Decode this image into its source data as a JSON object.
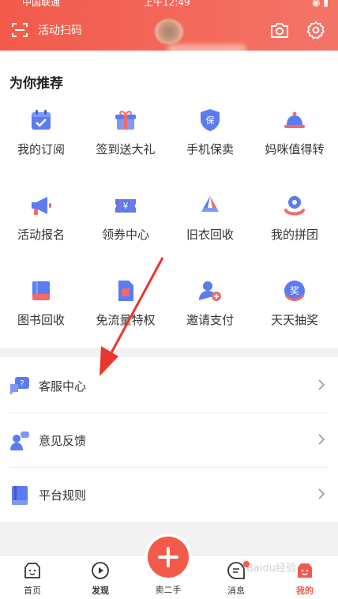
{
  "status_bar": {
    "carrier": "中国联通",
    "time": "上午12:49"
  },
  "header": {
    "scan_label": "活动扫码"
  },
  "recommend": {
    "title": "为你推荐",
    "items": [
      {
        "label": "我的订阅",
        "icon": "calendar-icon"
      },
      {
        "label": "签到送大礼",
        "icon": "gift-icon"
      },
      {
        "label": "手机保卖",
        "icon": "shield-icon"
      },
      {
        "label": "妈咪值得转",
        "icon": "bell-icon"
      },
      {
        "label": "活动报名",
        "icon": "megaphone-icon"
      },
      {
        "label": "领券中心",
        "icon": "coupon-icon"
      },
      {
        "label": "旧衣回收",
        "icon": "recycle-icon"
      },
      {
        "label": "我的拼团",
        "icon": "group-icon"
      },
      {
        "label": "图书回收",
        "icon": "book-icon"
      },
      {
        "label": "免流量特权",
        "icon": "sim-card-icon"
      },
      {
        "label": "邀请支付",
        "icon": "invite-icon"
      },
      {
        "label": "天天抽奖",
        "icon": "lottery-icon"
      }
    ]
  },
  "services": [
    {
      "label": "客服中心",
      "icon": "help-chat-icon"
    },
    {
      "label": "意见反馈",
      "icon": "feedback-icon"
    },
    {
      "label": "平台规则",
      "icon": "rules-book-icon"
    }
  ],
  "tabbar": {
    "home": "首页",
    "discover": "发现",
    "sell": "卖二手",
    "messages": "消息",
    "mine": "我的"
  },
  "watermark": "Baidu经验",
  "colors": {
    "accent": "#f25a4b",
    "icon_blue": "#5b7cf0",
    "icon_red": "#f26a6a"
  }
}
